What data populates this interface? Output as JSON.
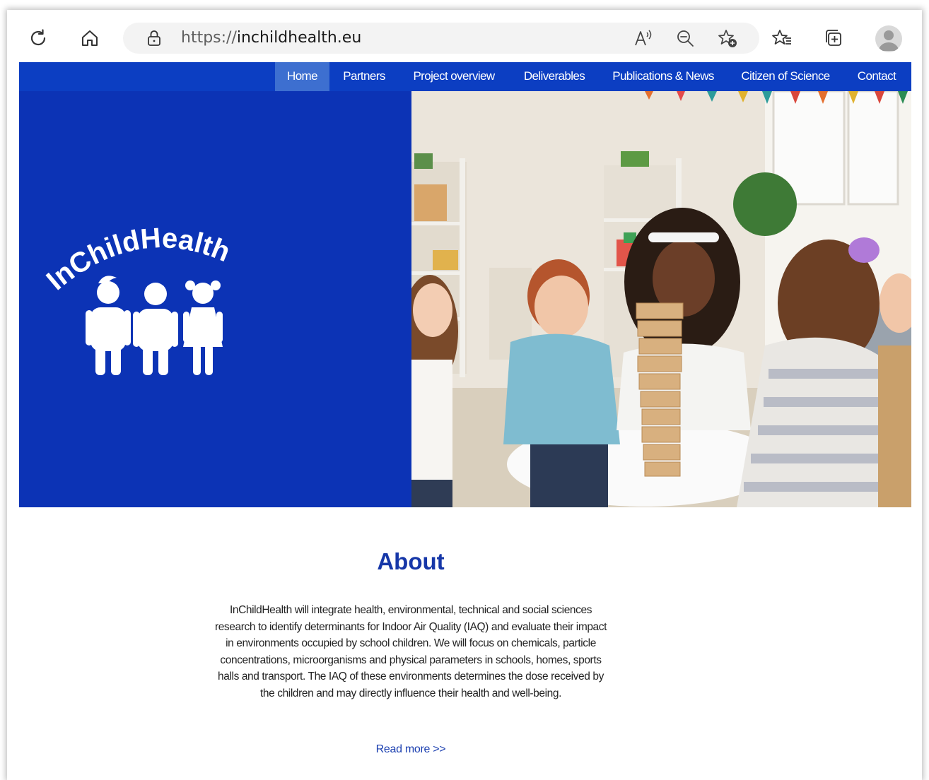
{
  "browser": {
    "url_protocol": "https://",
    "url_host": "inchildhealth.eu",
    "icons": [
      "refresh-icon",
      "home-icon",
      "lock-icon",
      "read-aloud-icon",
      "zoom-out-icon",
      "add-favorite-icon",
      "favorites-icon",
      "collections-icon",
      "profile-avatar"
    ]
  },
  "nav": {
    "items": [
      {
        "label": "Home",
        "active": true
      },
      {
        "label": "Partners",
        "active": false
      },
      {
        "label": "Project overview",
        "active": false
      },
      {
        "label": "Deliverables",
        "active": false
      },
      {
        "label": "Publications & News",
        "active": false
      },
      {
        "label": "Citizen of Science",
        "active": false
      },
      {
        "label": "Contact",
        "active": false
      }
    ],
    "background": "#0c3ec2",
    "active_background": "#3d6fd0"
  },
  "hero": {
    "logo_text": "InChildHealth",
    "logo_background": "#0c33b5",
    "photo_subject": "children playing a wooden block tower game around a white table"
  },
  "about": {
    "title": "About",
    "body": "InChildHealth will integrate health, environmental, technical and social sciences research to identify determinants for Indoor Air Quality (IAQ) and evaluate their impact in environments occupied by school children. We will focus on chemicals, particle concentrations, microorganisms and physical parameters in schools, homes, sports halls and transport. The IAQ of these environments determines the dose received by the children and may directly influence their health and well-being.",
    "read_more": "Read more >>",
    "title_color": "#1637a8"
  }
}
